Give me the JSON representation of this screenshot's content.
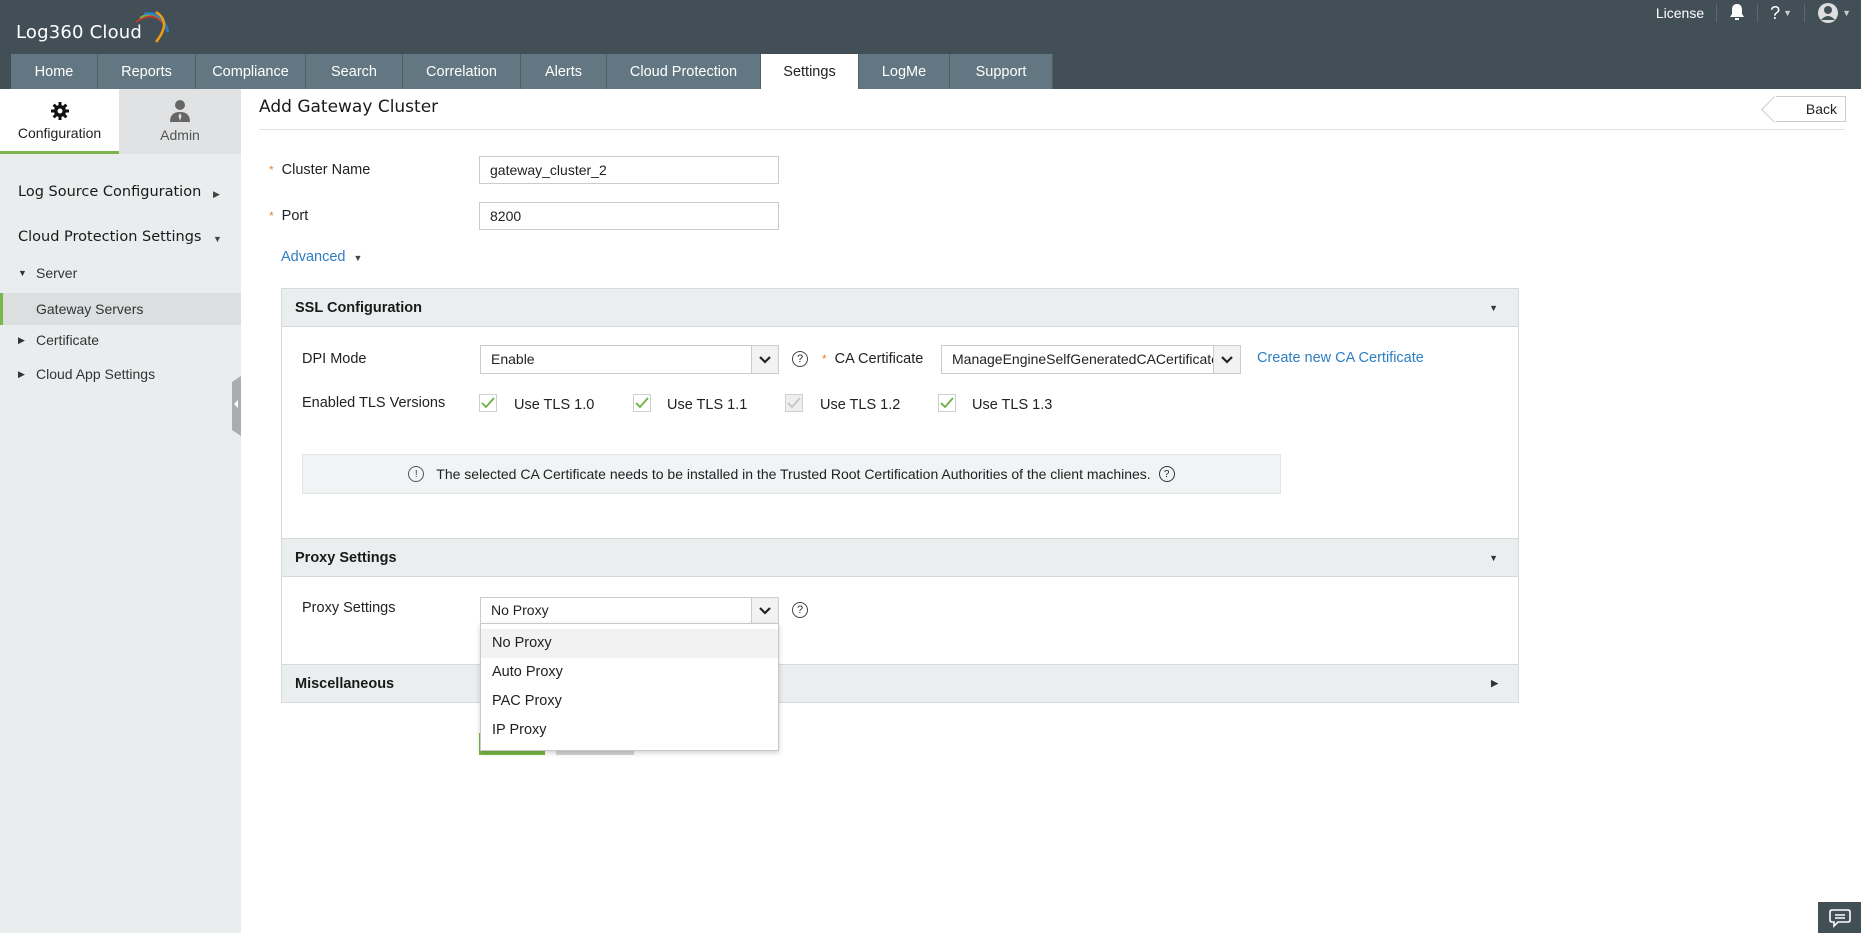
{
  "header": {
    "logo_text": "Log360 Cloud",
    "license_label": "License",
    "icons": [
      "bell-icon",
      "help-icon",
      "user-avatar-icon"
    ]
  },
  "nav": {
    "tabs": [
      {
        "label": "Home",
        "active": false
      },
      {
        "label": "Reports",
        "active": false
      },
      {
        "label": "Compliance",
        "active": false
      },
      {
        "label": "Search",
        "active": false
      },
      {
        "label": "Correlation",
        "active": false
      },
      {
        "label": "Alerts",
        "active": false
      },
      {
        "label": "Cloud Protection",
        "active": false
      },
      {
        "label": "Settings",
        "active": true
      },
      {
        "label": "LogMe",
        "active": false
      },
      {
        "label": "Support",
        "active": false
      }
    ]
  },
  "sidebar": {
    "tabs": [
      {
        "label": "Configuration",
        "icon": "gear-icon",
        "active": true
      },
      {
        "label": "Admin",
        "icon": "admin-user-icon",
        "active": false
      }
    ],
    "sections": [
      {
        "label": "Log Source Configuration",
        "expanded": false
      },
      {
        "label": "Cloud Protection Settings",
        "expanded": true
      }
    ],
    "tree": [
      {
        "label": "Server",
        "expanded": true
      },
      {
        "label": "Gateway Servers",
        "selected": true
      },
      {
        "label": "Certificate",
        "expanded": false
      },
      {
        "label": "Cloud App Settings",
        "expanded": false
      }
    ]
  },
  "main": {
    "title": "Add Gateway Cluster",
    "back_label": "Back",
    "cluster_name": {
      "label": "Cluster Name",
      "value": "gateway_cluster_2"
    },
    "port": {
      "label": "Port",
      "value": "8200"
    },
    "advanced_label": "Advanced",
    "ssl": {
      "title": "SSL Configuration",
      "dpi_mode": {
        "label": "DPI Mode",
        "value": "Enable"
      },
      "ca_certificate": {
        "label": "CA Certificate",
        "value": "ManageEngineSelfGeneratedCACertificate"
      },
      "create_ca_link": "Create new CA Certificate",
      "tls_label": "Enabled TLS Versions",
      "tls": [
        {
          "label": "Use TLS 1.0",
          "checked": true,
          "disabled": false
        },
        {
          "label": "Use TLS 1.1",
          "checked": true,
          "disabled": false
        },
        {
          "label": "Use TLS 1.2",
          "checked": true,
          "disabled": true
        },
        {
          "label": "Use TLS 1.3",
          "checked": true,
          "disabled": false
        }
      ],
      "note": "The selected CA Certificate needs to be installed in the Trusted Root Certification Authorities of the client machines."
    },
    "proxy": {
      "title": "Proxy Settings",
      "label": "Proxy Settings",
      "value": "No Proxy",
      "options": [
        "No Proxy",
        "Auto Proxy",
        "PAC Proxy",
        "IP Proxy"
      ],
      "highlighted": "No Proxy"
    },
    "misc": {
      "title": "Miscellaneous"
    }
  },
  "colors": {
    "header_bg": "#434f57",
    "nav_tab_bg": "#627781",
    "accent_green": "#7ab648",
    "link_blue": "#2d7ec4",
    "required_star": "#e0873a"
  }
}
